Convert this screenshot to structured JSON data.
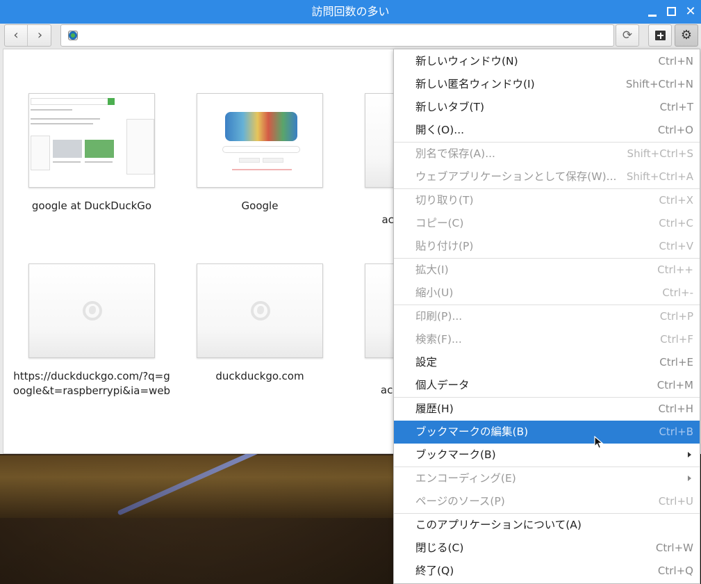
{
  "window": {
    "title": "訪問回数の多い"
  },
  "toolbar": {
    "back_icon": "chevron-left-icon",
    "forward_icon": "chevron-right-icon",
    "url_value": "",
    "reload_icon": "reload-icon",
    "new_tab_icon": "new-tab-icon",
    "settings_icon": "gear-icon"
  },
  "tiles": [
    {
      "label": "google at DuckDuckGo"
    },
    {
      "label": "Google"
    },
    {
      "label": "acco Service"
    },
    {
      "label": "https://duckduckgo.com/?q=google&t=raspberrypi&ia=web"
    },
    {
      "label": "duckduckgo.com"
    },
    {
      "label": "acco signin/v"
    }
  ],
  "menu": {
    "items": [
      {
        "label": "新しいウィンドウ(N)",
        "accel": "Ctrl+N",
        "enabled": true
      },
      {
        "label": "新しい匿名ウィンドウ(I)",
        "accel": "Shift+Ctrl+N",
        "enabled": true
      },
      {
        "label": "新しいタブ(T)",
        "accel": "Ctrl+T",
        "enabled": true
      },
      {
        "label": "開く(O)...",
        "accel": "Ctrl+O",
        "enabled": true
      },
      {
        "label": "別名で保存(A)...",
        "accel": "Shift+Ctrl+S",
        "enabled": false
      },
      {
        "label": "ウェブアプリケーションとして保存(W)...",
        "accel": "Shift+Ctrl+A",
        "enabled": false
      },
      {
        "label": "切り取り(T)",
        "accel": "Ctrl+X",
        "enabled": false
      },
      {
        "label": "コピー(C)",
        "accel": "Ctrl+C",
        "enabled": false
      },
      {
        "label": "貼り付け(P)",
        "accel": "Ctrl+V",
        "enabled": false
      },
      {
        "label": "拡大(I)",
        "accel": "Ctrl++",
        "enabled": false
      },
      {
        "label": "縮小(U)",
        "accel": "Ctrl+-",
        "enabled": false
      },
      {
        "label": "印刷(P)...",
        "accel": "Ctrl+P",
        "enabled": false
      },
      {
        "label": "検索(F)...",
        "accel": "Ctrl+F",
        "enabled": false
      },
      {
        "label": "設定",
        "accel": "Ctrl+E",
        "enabled": true
      },
      {
        "label": "個人データ",
        "accel": "Ctrl+M",
        "enabled": true
      },
      {
        "label": "履歴(H)",
        "accel": "Ctrl+H",
        "enabled": true
      },
      {
        "label": "ブックマークの編集(B)",
        "accel": "Ctrl+B",
        "enabled": true,
        "highlighted": true
      },
      {
        "label": "ブックマーク(B)",
        "accel": "",
        "enabled": true,
        "submenu": true
      },
      {
        "label": "エンコーディング(E)",
        "accel": "",
        "enabled": false,
        "submenu": true
      },
      {
        "label": "ページのソース(P)",
        "accel": "Ctrl+U",
        "enabled": false
      },
      {
        "label": "このアプリケーションについて(A)",
        "accel": "",
        "enabled": true
      },
      {
        "label": "閉じる(C)",
        "accel": "Ctrl+W",
        "enabled": true
      },
      {
        "label": "終了(Q)",
        "accel": "Ctrl+Q",
        "enabled": true
      }
    ]
  },
  "colors": {
    "titlebar": "#2f8ae6",
    "menu_highlight": "#2a7fd6"
  }
}
